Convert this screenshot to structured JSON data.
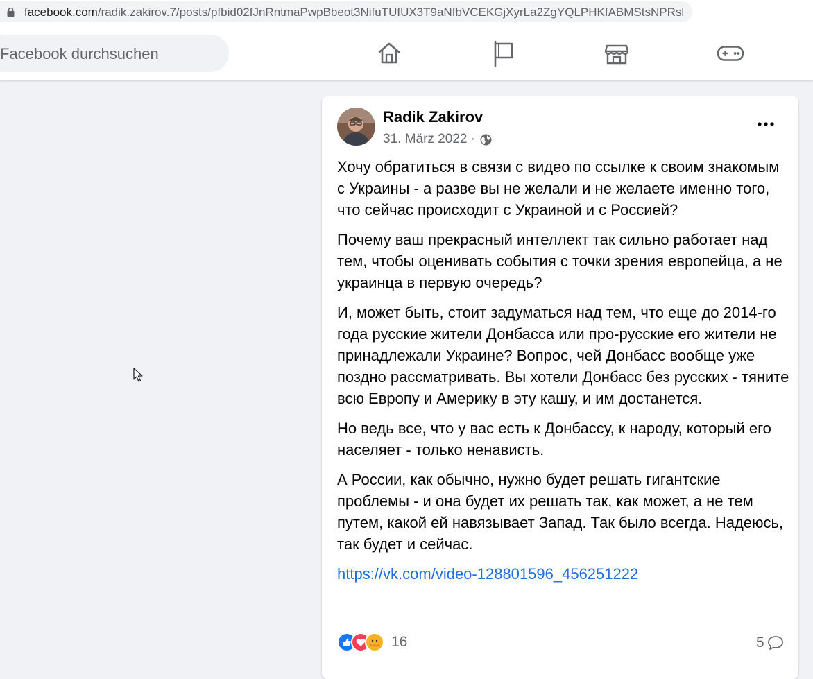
{
  "browser": {
    "url_host": "facebook.com",
    "url_path": "/radik.zakirov.7/posts/pfbid02fJnRntmaPwpBbeot3NifuTUfUX3T9aNfbVCEKGjXyrLa2ZgYQLPHKfABMStsNPRsl"
  },
  "topnav": {
    "search_placeholder": "Facebook durchsuchen",
    "icons": [
      "home-icon",
      "pages-flag-icon",
      "marketplace-icon",
      "gaming-icon"
    ]
  },
  "post": {
    "author": "Radik Zakirov",
    "date": "31. März 2022",
    "separator": "·",
    "paragraphs": [
      "Хочу обратиться в связи с видео по ссылке к своим знакомым с Украины - а разве вы не желали и не желаете именно того, что сейчас происходит с Украиной и с Россией?",
      "Почему ваш прекрасный интеллект так сильно работает над тем, чтобы оценивать события с точки зрения европейца, а не украинца в первую очередь?",
      "И, может быть, стоит задуматься над тем, что еще до 2014-го года русские жители Донбасса или про-русские его жители не принадлежали Украине?  Вопрос, чей Донбасс вообще уже поздно рассматривать.  Вы хотели Донбасс без русских - тяните всю Европу и Америку в эту кашу, и им достанется.",
      "Но ведь все, что у вас есть к Донбассу, к народу, который его населяет - только ненависть.",
      "А России, как обычно, нужно будет решать гигантские проблемы - и она будет их решать так, как может, а не тем путем, какой ей навязывает Запад.  Так было всегда. Надеюсь, так будет и сейчас."
    ],
    "link": "https://vk.com/video-128801596_456251222",
    "reaction_count": "16",
    "comment_count": "5",
    "colors": {
      "like": "#1877f2",
      "love": "#f33e58",
      "care": "#f7b125",
      "link": "#216fdb"
    }
  }
}
